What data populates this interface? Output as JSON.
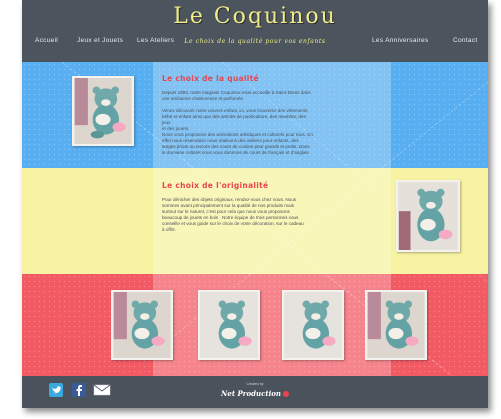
{
  "header": {
    "logo": "Le Coquinou",
    "tagline": "Le choix de la qualité pour vos enfants"
  },
  "nav": {
    "items": [
      "Accueil",
      "Jeux et Jouets",
      "Les Ateliers",
      "Les Anniversaires",
      "Contact"
    ]
  },
  "sections": {
    "quality": {
      "title": "Le choix de la qualité",
      "lines": [
        "Depuis 1993, notre magasin Coquinou vous accueille à Saint-Denis dans",
        "une ambiance chaleureuse et parfumée.",
        "",
        "Venez découvrir notre univers enfant, ici, vous trouverez des vêtements",
        "bébé et enfant ainsi que des articles de puériculture, des meubles, des",
        "jeux",
        "et des jouets.",
        "Nous vous proposons des animations artistiques et culturels pour tous. En",
        "effet nous réservation nous réalisons des ateliers pour enfants, des",
        "stages photo ou encore des cours de cuisine pour grands et petits. Dans",
        "le domaine culturel nous vous donnons de cours de français et d'anglais"
      ]
    },
    "originality": {
      "title": "Le choix de l'originalité",
      "lines": [
        "Pour dénicher des objets originaux, rendez-vous chez nous. Nous",
        "sommes avant principalement sur la qualité de nos produits mais",
        "surtout sur le naturel, c'est pour cela que nous vous proposons",
        "beaucoup de jouets en bois . Notre équipe de trois personnes vous",
        "conseille et vous guide sur le choix de votre décoration, sur le cadeau",
        "à offrir."
      ]
    }
  },
  "footer": {
    "social": [
      "twitter-icon",
      "facebook-icon",
      "mail-icon"
    ],
    "created_by": "Created by",
    "credit": "Net Production"
  },
  "colors": {
    "blue_band": "#57aef0",
    "yellow_band": "#f7f3a2",
    "red_band": "#f25a64",
    "header_bg": "#4c545e",
    "logo": "#f0ec8a",
    "title_accent": "#e8454f"
  }
}
